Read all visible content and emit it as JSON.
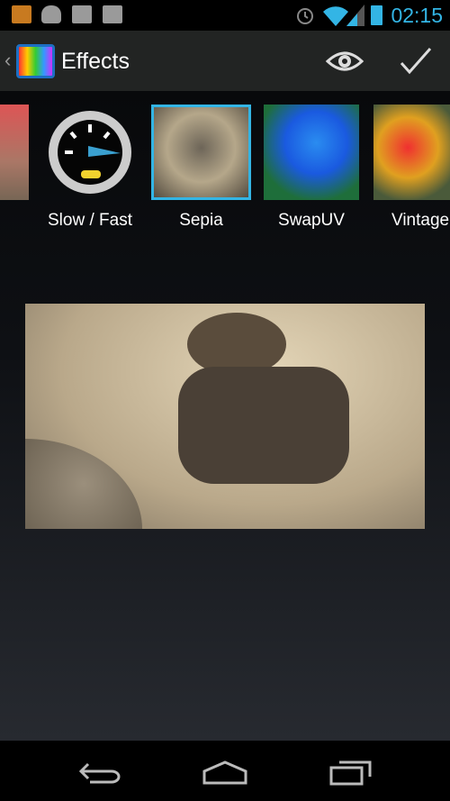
{
  "status_bar": {
    "time": "02:15",
    "icons": [
      "email-icon",
      "android-icon",
      "task-icon",
      "play-store-icon",
      "alarm-icon",
      "wifi-icon",
      "signal-icon",
      "battery-charging-icon"
    ]
  },
  "action_bar": {
    "title": "Effects",
    "preview_icon": "eye-icon",
    "confirm_icon": "checkmark-icon"
  },
  "effects": [
    {
      "label": "",
      "selected": false
    },
    {
      "label": "Slow / Fast",
      "selected": false
    },
    {
      "label": "Sepia",
      "selected": true
    },
    {
      "label": "SwapUV",
      "selected": false
    },
    {
      "label": "Vintage",
      "selected": false
    }
  ],
  "colors": {
    "accent": "#33b5e5",
    "action_bar": "#222423"
  },
  "nav_bar": {
    "icons": [
      "back-icon",
      "home-icon",
      "recent-apps-icon"
    ]
  }
}
